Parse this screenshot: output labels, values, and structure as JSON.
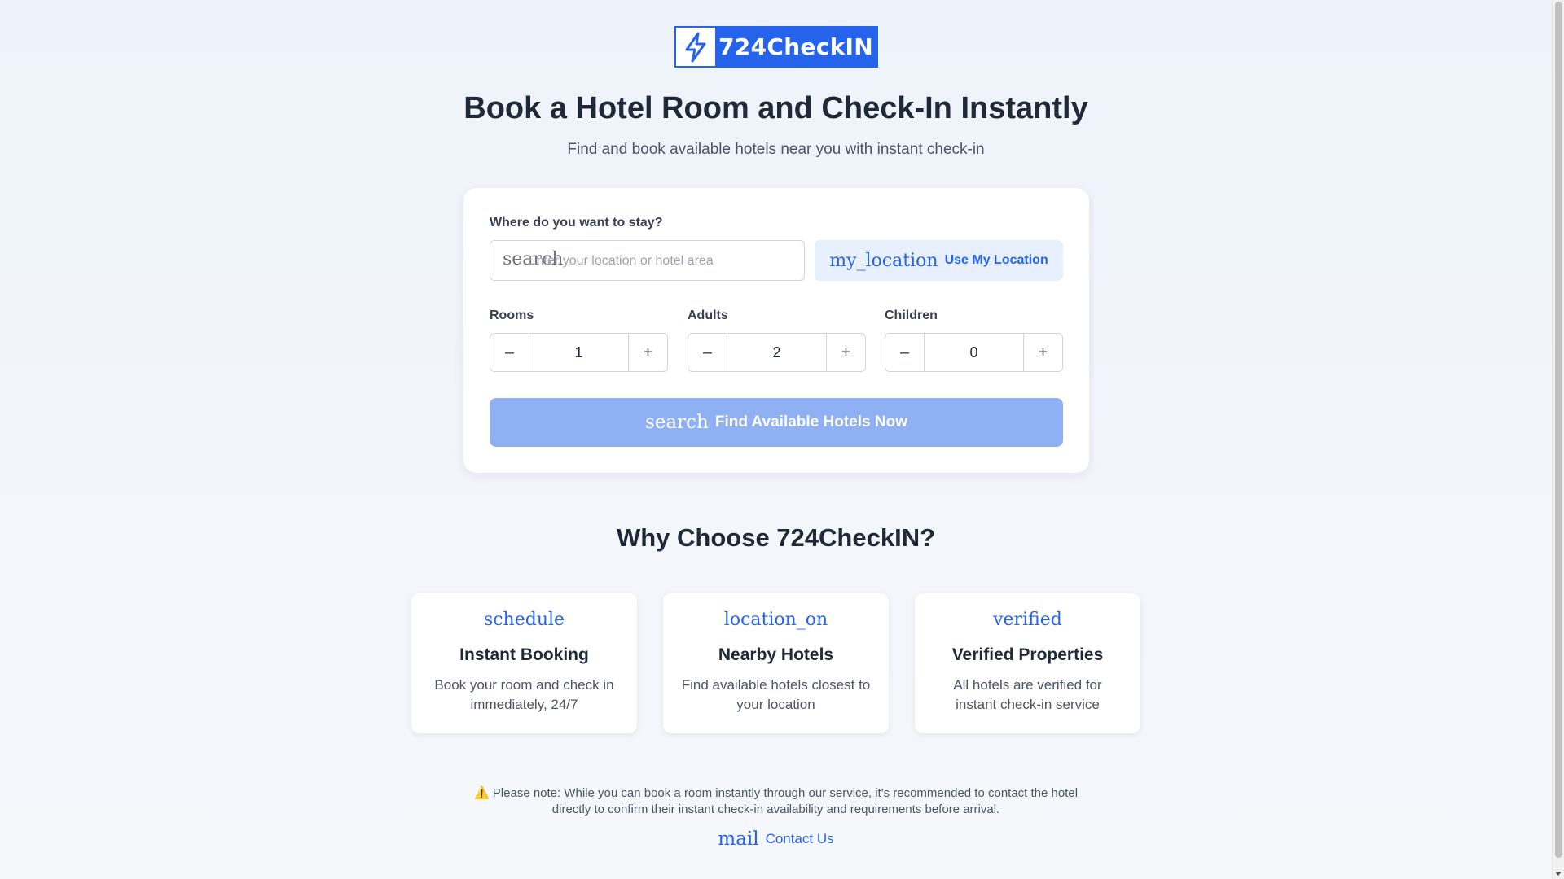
{
  "brand": {
    "name": "724CheckIN",
    "logo_icon": "lightning-bolt-icon",
    "primary_color": "#2563eb"
  },
  "hero": {
    "title": "Book a Hotel Room and Check-In Instantly",
    "subtitle": "Find and book available hotels near you with instant check-in"
  },
  "search": {
    "location_label": "Where do you want to stay?",
    "location_icon": "search",
    "location_placeholder": "Enter your location or hotel area",
    "location_value": "",
    "use_location_icon": "my_location",
    "use_location_label": "Use My Location",
    "steppers": [
      {
        "label": "Rooms",
        "value": "1",
        "minus": "–",
        "plus": "+"
      },
      {
        "label": "Adults",
        "value": "2",
        "minus": "–",
        "plus": "+"
      },
      {
        "label": "Children",
        "value": "0",
        "minus": "–",
        "plus": "+"
      }
    ],
    "submit_icon": "search",
    "submit_label": "Find Available Hotels Now"
  },
  "why": {
    "title": "Why Choose 724CheckIN?",
    "features": [
      {
        "icon": "schedule",
        "title": "Instant Booking",
        "description": "Book your room and check in immediately, 24/7"
      },
      {
        "icon": "location_on",
        "title": "Nearby Hotels",
        "description": "Find available hotels closest to your location"
      },
      {
        "icon": "verified",
        "title": "Verified Properties",
        "description": "All hotels are verified for instant check-in service"
      }
    ]
  },
  "footer": {
    "notice": "⚠️ Please note: While you can book a room instantly through our service, it's recommended to contact the hotel directly to confirm their instant check-in availability and requirements before arrival.",
    "contact_icon": "mail",
    "contact_label": "Contact Us"
  }
}
